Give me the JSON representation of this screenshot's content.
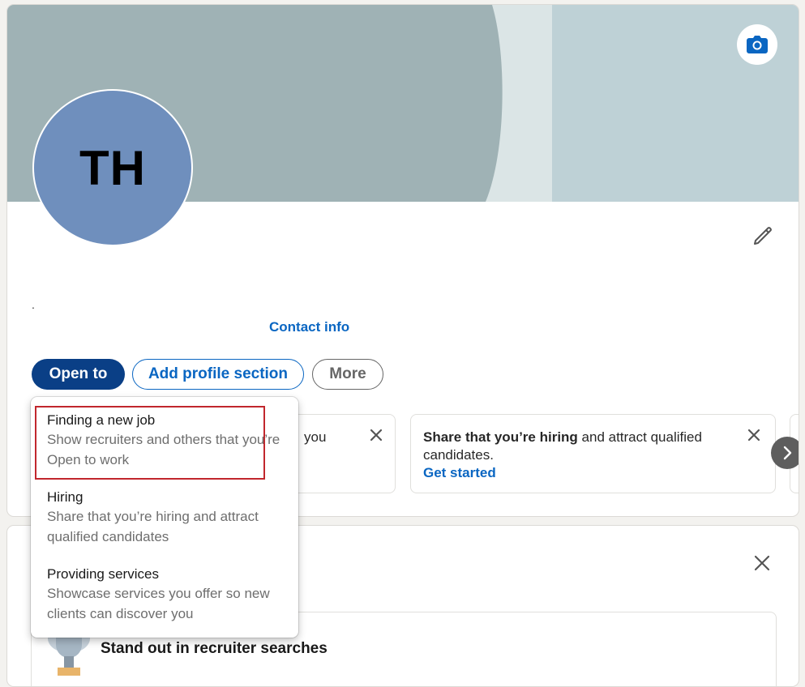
{
  "profile": {
    "initials": "TH",
    "headline_placeholder": ".",
    "contact_info": "Contact info"
  },
  "actions": {
    "open_to": "Open to",
    "add_section": "Add profile section",
    "more": "More"
  },
  "suggestions": [
    {
      "partial_text": "you"
    },
    {
      "bold": "Share that you’re hiring",
      "rest": " and attract qualified candidates.",
      "link": "Get started"
    }
  ],
  "dropdown": {
    "items": [
      {
        "title": "Finding a new job",
        "desc": "Show recruiters and others that you’re Open to work"
      },
      {
        "title": "Hiring",
        "desc": "Share that you’re hiring and attract qualified candidates"
      },
      {
        "title": "Providing services",
        "desc": "Showcase services you offer so new clients can discover you"
      }
    ]
  },
  "second_card": {
    "inner_title": "Stand out in recruiter searches"
  },
  "icons": {
    "camera": "camera-icon",
    "edit": "pencil-icon",
    "close": "close-icon",
    "next": "chevron-right-icon",
    "trophy": "trophy-icon"
  },
  "colors": {
    "brand_blue": "#0a66c2",
    "primary_button": "#0a3f86",
    "highlight": "#c1272d",
    "avatar_bg": "#6f8fbd"
  }
}
